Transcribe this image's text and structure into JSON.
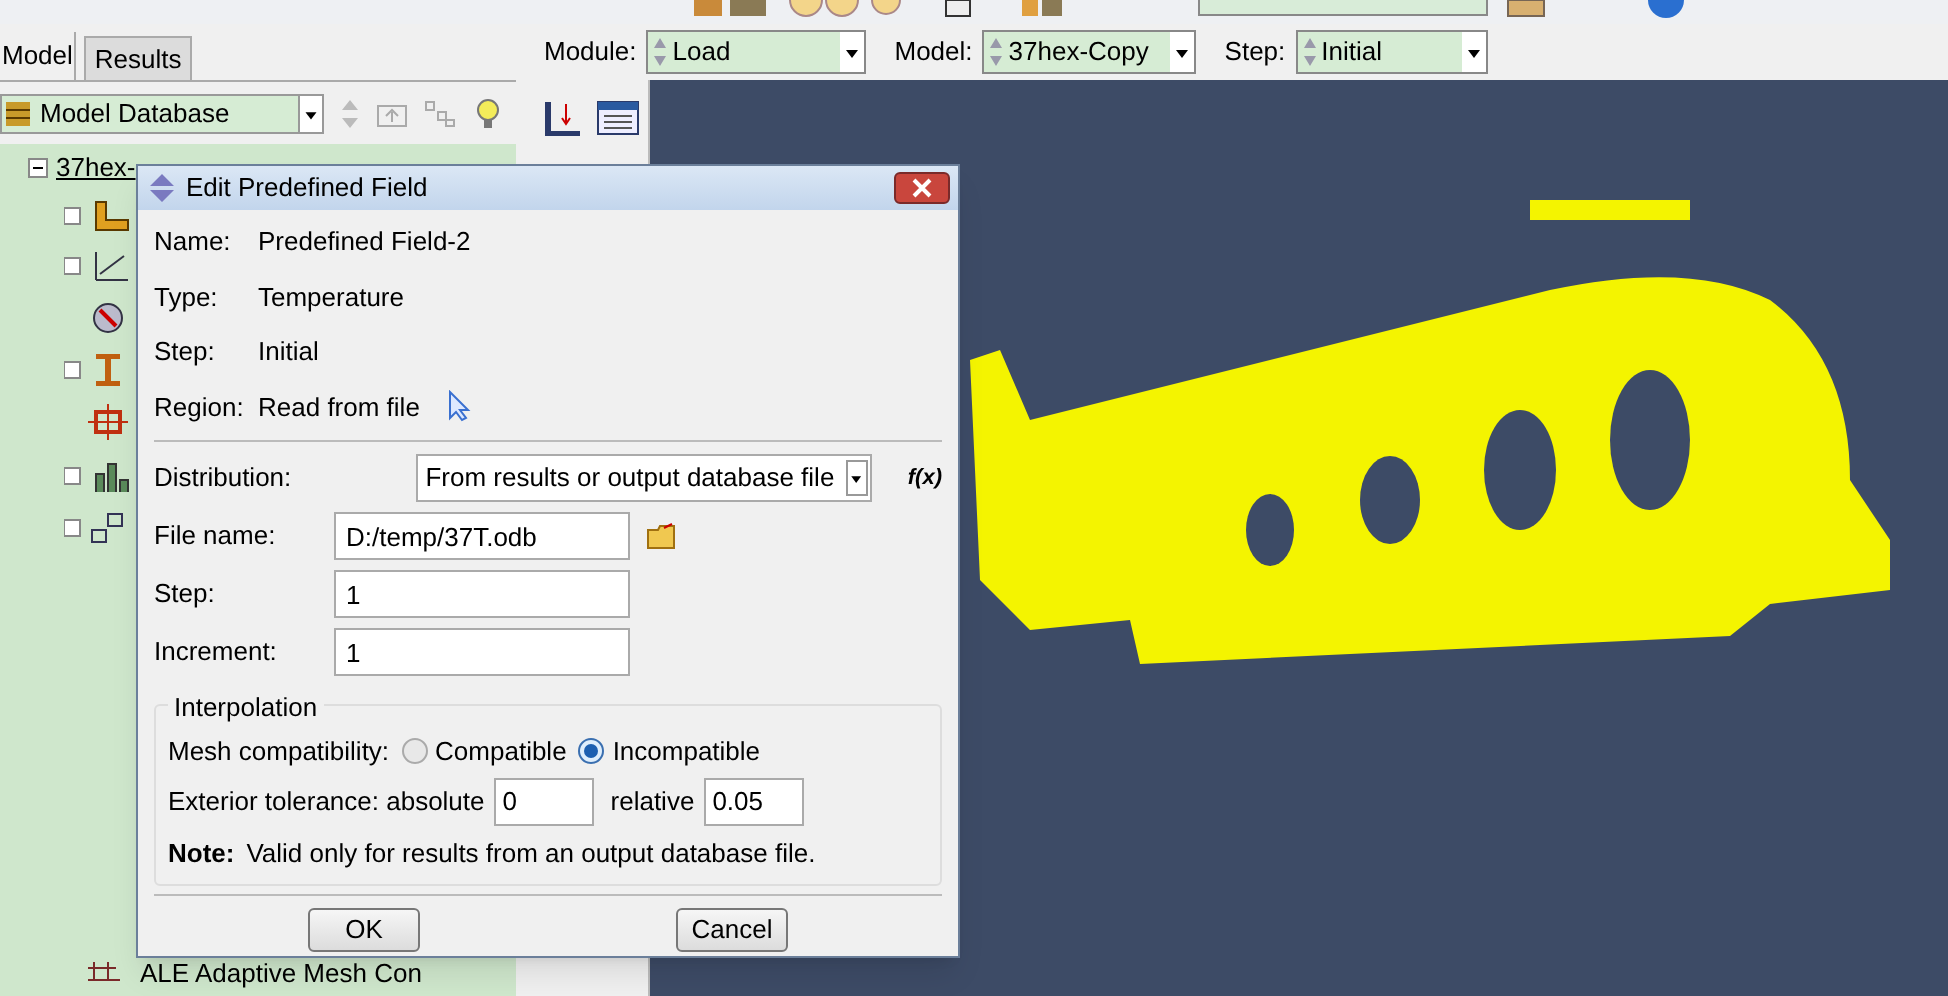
{
  "left_tabs": [
    {
      "label": "Model",
      "selected": true
    },
    {
      "label": "Results",
      "selected": false
    }
  ],
  "model_combo": {
    "value": "Model Database"
  },
  "tree": {
    "root": {
      "label": "37hex-",
      "expanded": true
    },
    "last_item": {
      "label": "ALE Adaptive Mesh Con"
    }
  },
  "context_bar": [
    {
      "label": "Module:",
      "value": "Load"
    },
    {
      "label": "Model:",
      "value": "37hex-Copy"
    },
    {
      "label": "Step:",
      "value": "Initial"
    }
  ],
  "dialog": {
    "title": "Edit Predefined Field",
    "info": [
      {
        "label": "Name:",
        "value": "Predefined Field-2"
      },
      {
        "label": "Type:",
        "value": "Temperature"
      },
      {
        "label": "Step:",
        "value": "Initial"
      },
      {
        "label": "Region:",
        "value": "Read from file"
      }
    ],
    "distribution": {
      "label": "Distribution:",
      "value": "From results or output database file",
      "fx": "f(x)"
    },
    "fields": [
      {
        "label": "File name:",
        "value": "D:/temp/37T.odb",
        "kind": "file"
      },
      {
        "label": "Step:",
        "value": "1",
        "kind": "text"
      },
      {
        "label": "Increment:",
        "value": "1",
        "kind": "text"
      }
    ],
    "interpolation": {
      "title": "Interpolation",
      "compat_label": "Mesh compatibility:",
      "options": [
        {
          "label": "Compatible",
          "selected": false
        },
        {
          "label": "Incompatible",
          "selected": true
        }
      ],
      "tolerance_label": "Exterior tolerance: absolute",
      "absolute": "0",
      "relative_label": "relative",
      "relative": "0.05",
      "note_label": "Note:",
      "note": "Valid only for results from an output database file."
    },
    "buttons": [
      "OK",
      "Cancel"
    ]
  }
}
